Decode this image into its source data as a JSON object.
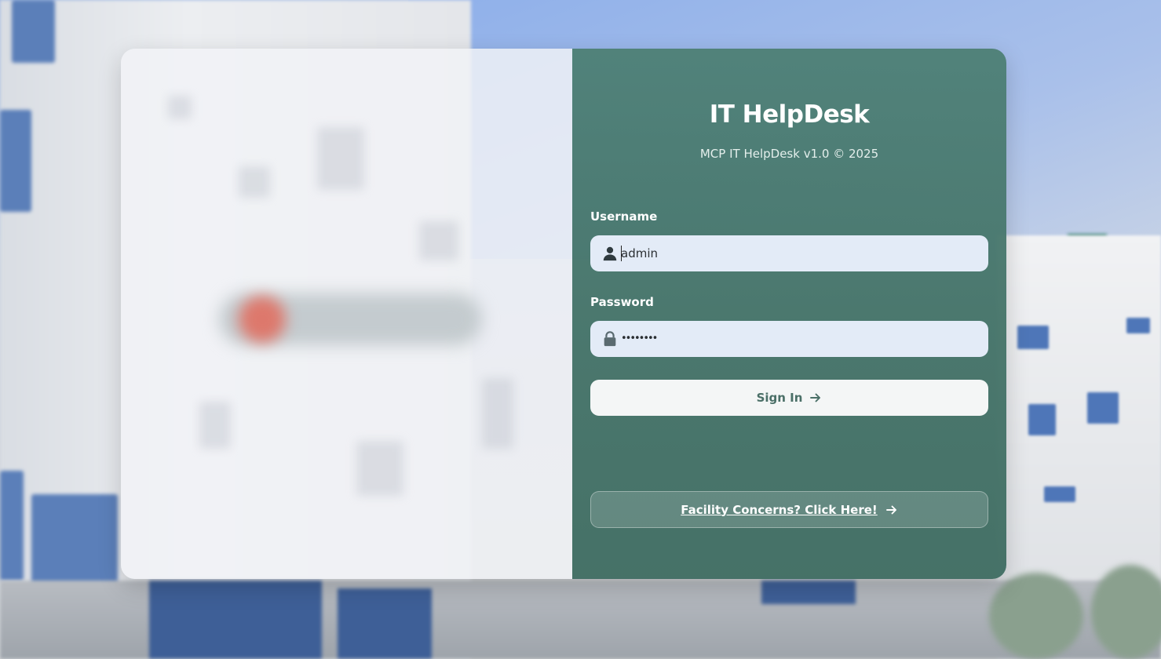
{
  "app": {
    "title": "IT HelpDesk",
    "subtitle": "MCP IT HelpDesk v1.0 © 2025"
  },
  "form": {
    "username_label": "Username",
    "username_value": "admin",
    "password_label": "Password",
    "password_value": "••••••••",
    "signin_label": "Sign In"
  },
  "footer": {
    "facility_link": "Facility Concerns? Click Here!"
  },
  "icons": {
    "username": "user-icon",
    "password": "lock-icon",
    "signin": "arrow-right-icon",
    "facility": "arrow-right-icon"
  },
  "colors": {
    "panel_accent": "#4e8076",
    "input_bg": "#e3ebf7",
    "button_bg": "#f4f6f6",
    "button_text": "#4a6f67"
  }
}
